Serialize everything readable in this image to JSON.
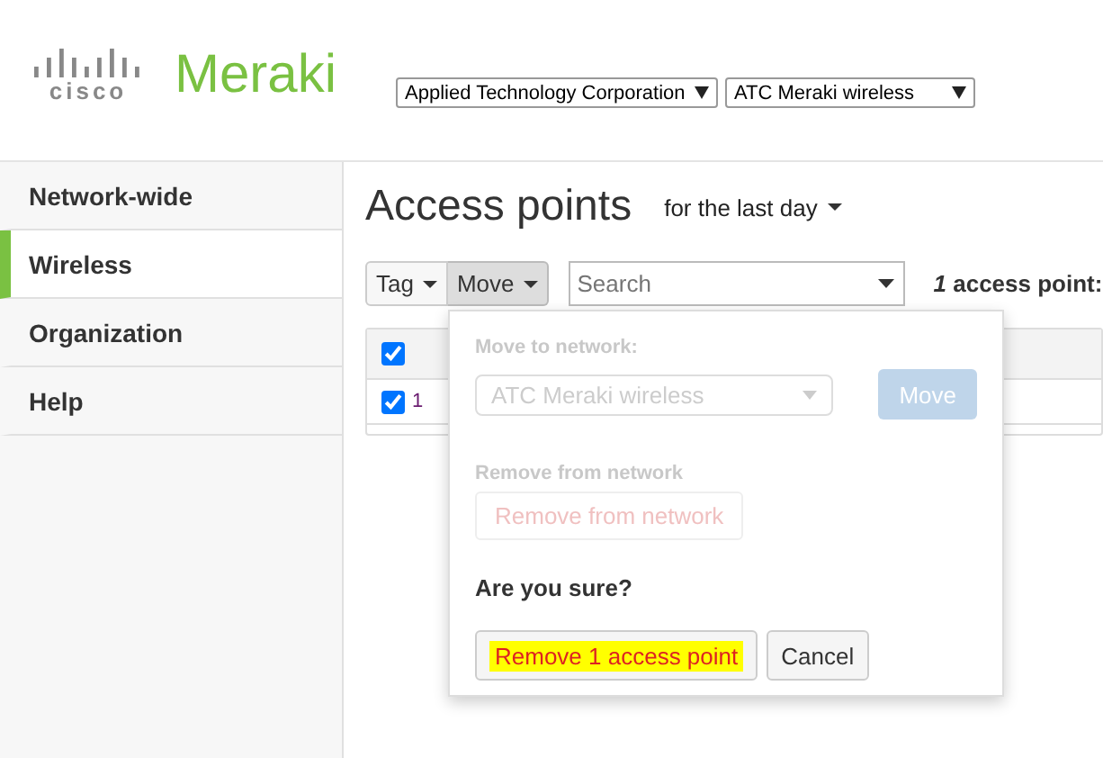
{
  "header": {
    "logo_wordmark": "cisco",
    "logo_text": "Meraki",
    "org_select": "Applied Technology Corporation",
    "network_select": "ATC Meraki wireless"
  },
  "sidebar": {
    "items": [
      {
        "label": "Network-wide",
        "selected": false
      },
      {
        "label": "Wireless",
        "selected": true
      },
      {
        "label": "Organization",
        "selected": false
      },
      {
        "label": "Help",
        "selected": false
      }
    ]
  },
  "page": {
    "title": "Access points",
    "timespan": "for the last day"
  },
  "toolbar": {
    "buttons": [
      {
        "label": "Tag",
        "pressed": false
      },
      {
        "label": "Move",
        "pressed": true
      }
    ],
    "search": {
      "placeholder": "Search"
    },
    "count": "1",
    "count_label": "access point:"
  },
  "table": {
    "header_checked": true,
    "rows": [
      {
        "checked": true,
        "column_1": "1"
      }
    ]
  },
  "move_popover": {
    "move_label": "Move to network:",
    "network_select": {
      "value": "ATC Meraki wireless",
      "disabled": true
    },
    "move_button": {
      "label": "Move",
      "disabled": true
    },
    "remove_label": "Remove from network",
    "remove_button": {
      "label": "Remove from network",
      "disabled": true
    },
    "confirm_prompt": "Are you sure?",
    "confirm_button": {
      "label": "Remove 1 access point",
      "highlighted": true
    },
    "cancel_button": "Cancel"
  }
}
